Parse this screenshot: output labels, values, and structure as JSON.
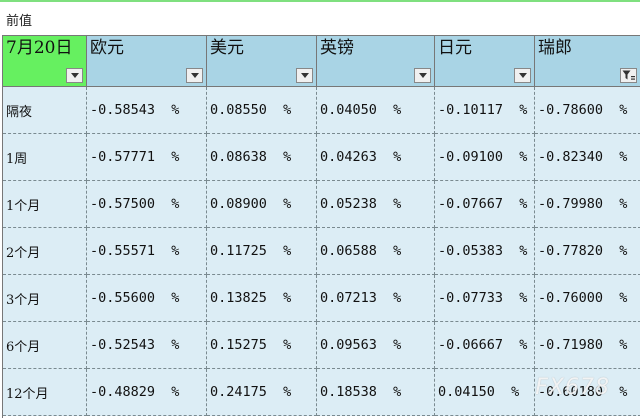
{
  "sheet_label": "前值",
  "headers": [
    {
      "label": "7月20日",
      "filter": "dropdown"
    },
    {
      "label": "欧元",
      "filter": "dropdown"
    },
    {
      "label": "美元",
      "filter": "dropdown"
    },
    {
      "label": "英镑",
      "filter": "dropdown"
    },
    {
      "label": "日元",
      "filter": "dropdown"
    },
    {
      "label": "瑞郎",
      "filter": "applied"
    }
  ],
  "rows": [
    [
      "隔夜",
      "-0.58543  %",
      "0.08550  %",
      "0.04050  %",
      "-0.10117  %",
      "-0.78600  %"
    ],
    [
      "1周",
      "-0.57771  %",
      "0.08638  %",
      "0.04263  %",
      "-0.09100  %",
      "-0.82340  %"
    ],
    [
      "1个月",
      "-0.57500  %",
      "0.08900  %",
      "0.05238  %",
      "-0.07667  %",
      "-0.79980  %"
    ],
    [
      "2个月",
      "-0.55571  %",
      "0.11725  %",
      "0.06588  %",
      "-0.05383  %",
      "-0.77820  %"
    ],
    [
      "3个月",
      "-0.55600  %",
      "0.13825  %",
      "0.07213  %",
      "-0.07733  %",
      "-0.76000  %"
    ],
    [
      "6个月",
      "-0.52543  %",
      "0.15275  %",
      "0.09563  %",
      "-0.06667  %",
      "-0.71980  %"
    ],
    [
      "12个月",
      "-0.48829  %",
      "0.24175  %",
      "0.18538  %",
      "0.04150  %",
      "-0.60180  %"
    ]
  ],
  "watermark": "FX678",
  "colors": {
    "header": "#a9d4e5",
    "date_header": "#66f060",
    "cell": "#dcedf5"
  }
}
